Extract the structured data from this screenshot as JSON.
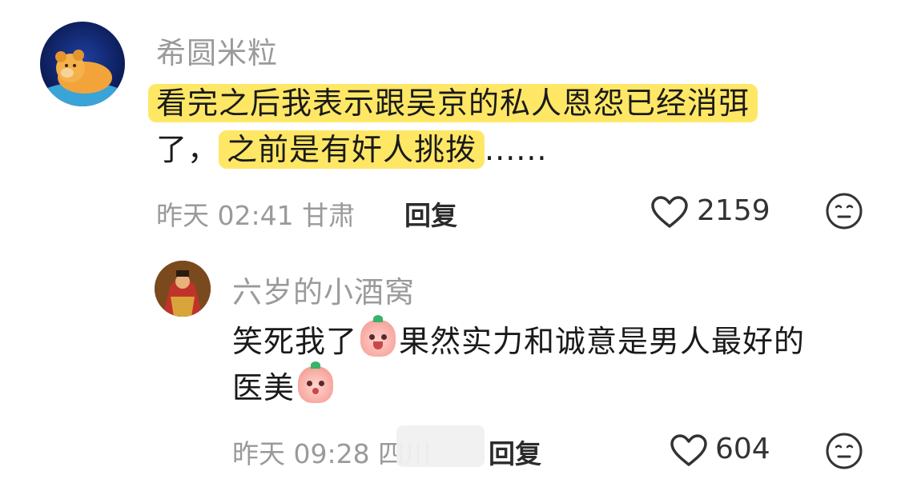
{
  "comments": [
    {
      "user": "希圆米粒",
      "text_plain_start": "",
      "text_hl1": "看完之后我表示跟吴京的私人恩怨已经消弭",
      "text_mid": "了，",
      "text_hl2": "之前是有奸人挑拨",
      "text_end": "......",
      "time": "昨天 02:41 甘肃",
      "reply_label": "回复",
      "likes": "2159"
    },
    {
      "user": "六岁的小酒窝",
      "line1_a": "笑死我了",
      "line1_b": "果然实力和诚意是男人最好的",
      "line2": "医美",
      "time": "昨天 09:28 四川",
      "reply_label": "回复",
      "likes": "604"
    }
  ],
  "icons": {
    "like": "heart-outline-icon",
    "dislike": "neutral-face-icon",
    "emoji1": "laughing-crying-emoji",
    "emoji2": "shy-emoji"
  },
  "colors": {
    "highlight": "#ffe766",
    "muted": "#9a9a9a"
  }
}
